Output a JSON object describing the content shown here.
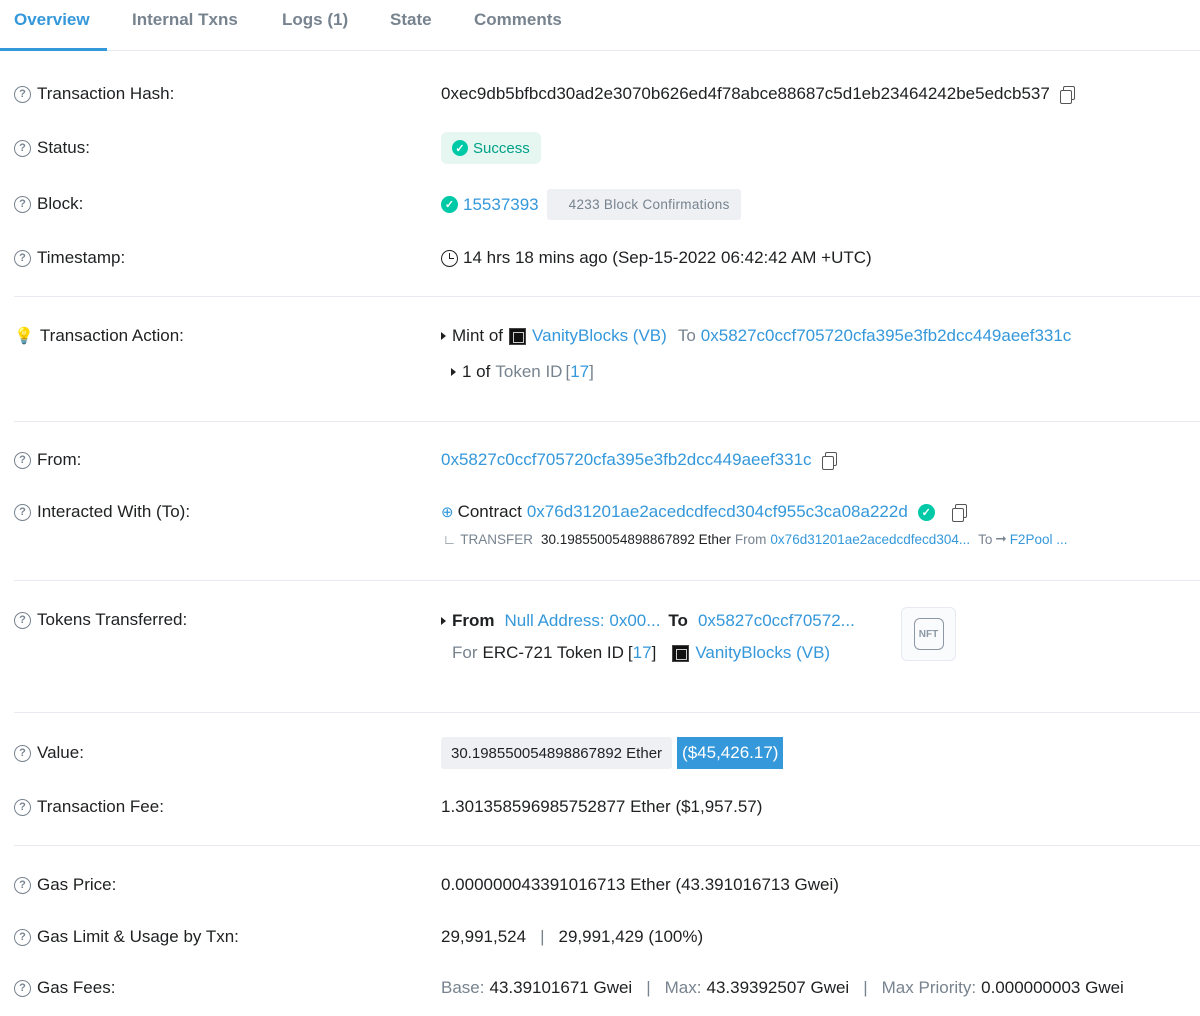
{
  "tabs": [
    {
      "label": "Overview"
    },
    {
      "label": "Internal Txns"
    },
    {
      "label": "Logs (1)"
    },
    {
      "label": "State"
    },
    {
      "label": "Comments"
    }
  ],
  "tx_hash": {
    "label": "Transaction Hash:",
    "value": "0xec9db5bfbcd30ad2e3070b626ed4f78abce88687c5d1eb23464242be5edcb537"
  },
  "status": {
    "label": "Status:",
    "value": "Success"
  },
  "block": {
    "label": "Block:",
    "number": "15537393",
    "confirmations": "4233 Block Confirmations"
  },
  "timestamp": {
    "label": "Timestamp:",
    "value": "14 hrs 18 mins ago (Sep-15-2022 06:42:42 AM +UTC)"
  },
  "tx_action": {
    "label": "Transaction Action:",
    "mint_prefix": "Mint of",
    "token_name": "VanityBlocks (VB)",
    "to_label": "To",
    "to_address": "0x5827c0ccf705720cfa395e3fb2dcc449aeef331c",
    "sub_prefix": "1 of",
    "sub_token_id_label": "Token ID",
    "sub_token_id_open": "[",
    "sub_token_id": "17",
    "sub_token_id_close": "]"
  },
  "from": {
    "label": "From:",
    "address": "0x5827c0ccf705720cfa395e3fb2dcc449aeef331c"
  },
  "interacted": {
    "label": "Interacted With (To):",
    "contract_label": "Contract",
    "contract_address": "0x76d31201ae2acedcdfecd304cf955c3ca08a222d",
    "transfer_label": "TRANSFER",
    "transfer_amount": "30.198550054898867892 Ether",
    "transfer_from_label": "From",
    "transfer_from": "0x76d31201ae2acedcdfecd304...",
    "transfer_to_label": "To",
    "transfer_to": "F2Pool ..."
  },
  "tokens": {
    "label": "Tokens Transferred:",
    "from_label": "From",
    "from_value": "Null Address: 0x00...",
    "to_label": "To",
    "to_value": "0x5827c0ccf70572...",
    "for_label": "For",
    "erc_label": "ERC-721 Token ID",
    "bracket_open": "[",
    "token_id": "17",
    "bracket_close": "]",
    "token_name": "VanityBlocks (VB)",
    "nft_badge": "NFT"
  },
  "value": {
    "label": "Value:",
    "ether": "30.198550054898867892 Ether",
    "usd": "($45,426.17)"
  },
  "fee": {
    "label": "Transaction Fee:",
    "value": "1.301358596985752877 Ether ($1,957.57)"
  },
  "gas_price": {
    "label": "Gas Price:",
    "value": "0.000000043391016713 Ether (43.391016713 Gwei)"
  },
  "gas_limit": {
    "label": "Gas Limit & Usage by Txn:",
    "limit": "29,991,524",
    "separator": "|",
    "usage": "29,991,429 (100%)"
  },
  "gas_fees": {
    "label": "Gas Fees:",
    "base_label": "Base:",
    "base_value": "43.39101671 Gwei",
    "max_label": "Max:",
    "max_value": "43.39392507 Gwei",
    "priority_label": "Max Priority:",
    "priority_value": "0.000000003 Gwei",
    "separator": "|"
  },
  "colors": {
    "accent": "#3498db",
    "success": "#00c9a7",
    "muted": "#77838f"
  },
  "icons": {
    "question": "?",
    "check": "✓",
    "arrow": "➞",
    "corner": "∟"
  }
}
